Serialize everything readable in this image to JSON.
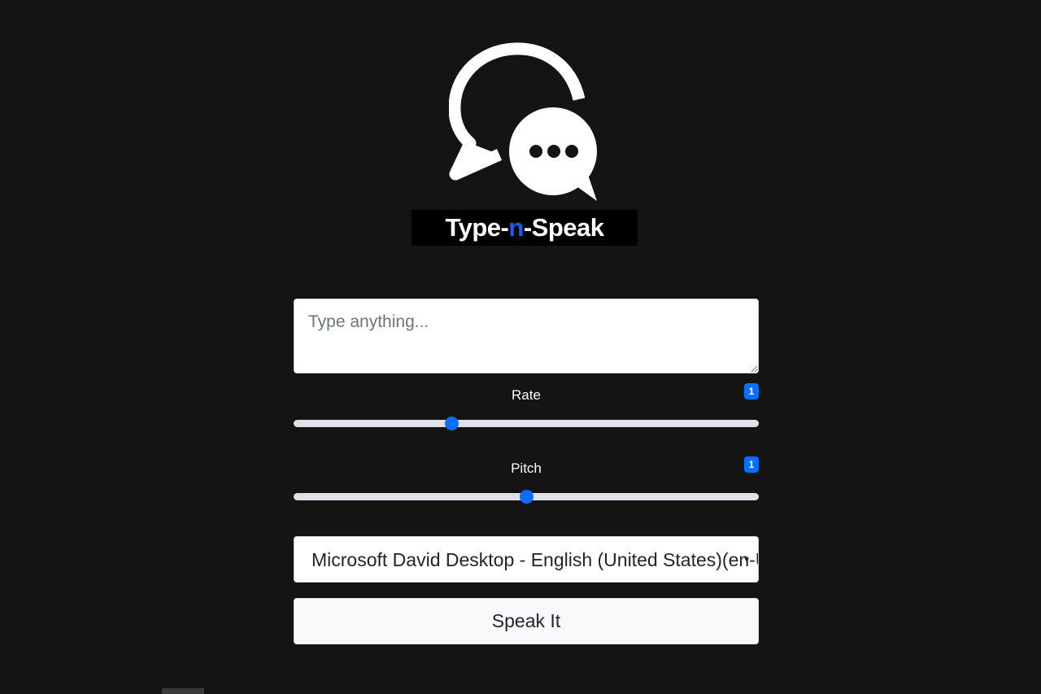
{
  "logo": {
    "title_prefix": "Type-",
    "title_accent": "n",
    "title_suffix": "-Speak",
    "accent_color": "#1a5cff",
    "icon": "chat-bubbles-icon"
  },
  "text_input": {
    "placeholder": "Type anything...",
    "value": ""
  },
  "rate": {
    "label": "Rate",
    "value": "1",
    "level_fraction": 0.34
  },
  "pitch": {
    "label": "Pitch",
    "value": "1",
    "level_fraction": 0.5
  },
  "voice_select": {
    "selected": "Microsoft David Desktop - English (United States)(en-US)",
    "caret_icon": "caret-down-icon"
  },
  "speak_button": {
    "label": "Speak It"
  },
  "colors": {
    "background": "#141414",
    "accent": "#0d6efd"
  }
}
